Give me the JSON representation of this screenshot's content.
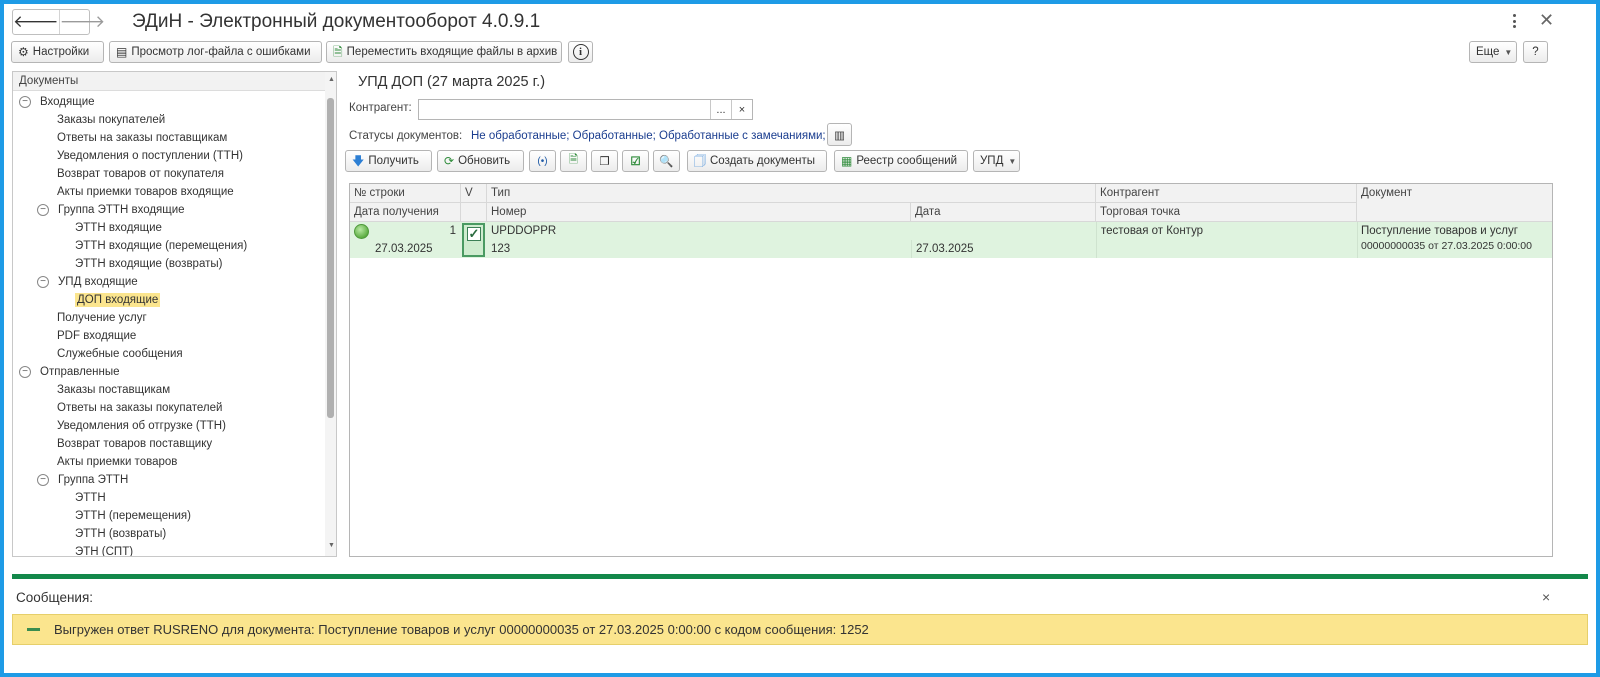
{
  "app": {
    "title": "ЭДиН - Электронный документооборот 4.0.9.1"
  },
  "toolbar": {
    "settings": "Настройки",
    "view_log": "Просмотр лог-файла с ошибками",
    "move_archive": "Переместить входящие файлы в архив",
    "more": "Еще",
    "help": "?"
  },
  "tree": {
    "header": "Документы",
    "items": [
      {
        "label": "Входящие",
        "level": 0,
        "expandable": true
      },
      {
        "label": "Заказы покупателей",
        "level": 2
      },
      {
        "label": "Ответы на заказы поставщикам",
        "level": 2
      },
      {
        "label": "Уведомления о поступлении (ТТН)",
        "level": 2
      },
      {
        "label": "Возврат товаров от покупателя",
        "level": 2
      },
      {
        "label": "Акты приемки товаров входящие",
        "level": 2
      },
      {
        "label": "Группа ЭТТН входящие",
        "level": 1,
        "expandable": true
      },
      {
        "label": "ЭТТН входящие",
        "level": 3
      },
      {
        "label": "ЭТТН входящие (перемещения)",
        "level": 3
      },
      {
        "label": "ЭТТН входящие (возвраты)",
        "level": 3
      },
      {
        "label": "УПД входящие",
        "level": 1,
        "expandable": true
      },
      {
        "label": "ДОП входящие",
        "level": 3,
        "selected": true
      },
      {
        "label": "Получение услуг",
        "level": 2
      },
      {
        "label": "PDF входящие",
        "level": 2
      },
      {
        "label": "Служебные сообщения",
        "level": 2
      },
      {
        "label": "Отправленные",
        "level": 0,
        "expandable": true
      },
      {
        "label": "Заказы поставщикам",
        "level": 2
      },
      {
        "label": "Ответы на заказы покупателей",
        "level": 2
      },
      {
        "label": "Уведомления об отгрузке (ТТН)",
        "level": 2
      },
      {
        "label": "Возврат товаров поставщику",
        "level": 2
      },
      {
        "label": "Акты приемки товаров",
        "level": 2
      },
      {
        "label": "Группа ЭТТН",
        "level": 1,
        "expandable": true
      },
      {
        "label": "ЭТТН",
        "level": 3
      },
      {
        "label": "ЭТТН (перемещения)",
        "level": 3
      },
      {
        "label": "ЭТТН (возвраты)",
        "level": 3
      },
      {
        "label": "ЭТН (СПТ)",
        "level": 3
      }
    ]
  },
  "main": {
    "title": "УПД ДОП (27 марта 2025 г.)",
    "contractor_label": "Контрагент:",
    "contractor_value": "",
    "contractor_select": "...",
    "contractor_clear": "×",
    "status_label": "Статусы документов:",
    "status_value": "Не обработанные; Обработанные; Обработанные с замечаниями;",
    "actions": {
      "receive": "Получить",
      "refresh": "Обновить",
      "create_docs": "Создать документы",
      "registry": "Реестр сообщений",
      "upd": "УПД"
    }
  },
  "grid": {
    "headers": {
      "row_no": "№ строки",
      "v": "V",
      "type": "Тип",
      "contractor": "Контрагент",
      "document": "Документ",
      "date_received": "Дата получения",
      "number": "Номер",
      "date": "Дата",
      "trade_point": "Торговая точка"
    },
    "rows": [
      {
        "row_no": "1",
        "checked": true,
        "date_received": "27.03.2025",
        "type": "UPDDOPPR",
        "number": "123",
        "date": "27.03.2025",
        "contractor": "тестовая от Контур",
        "trade_point": "",
        "document_line1": "Поступление товаров и услуг",
        "document_line2": "00000000035 от 27.03.2025 0:00:00"
      }
    ]
  },
  "messages": {
    "title": "Сообщения:",
    "close": "×",
    "text": "Выгружен ответ RUSRENO для документа: Поступление товаров и услуг 00000000035 от 27.03.2025 0:00:00 с кодом сообщения: 1252"
  }
}
